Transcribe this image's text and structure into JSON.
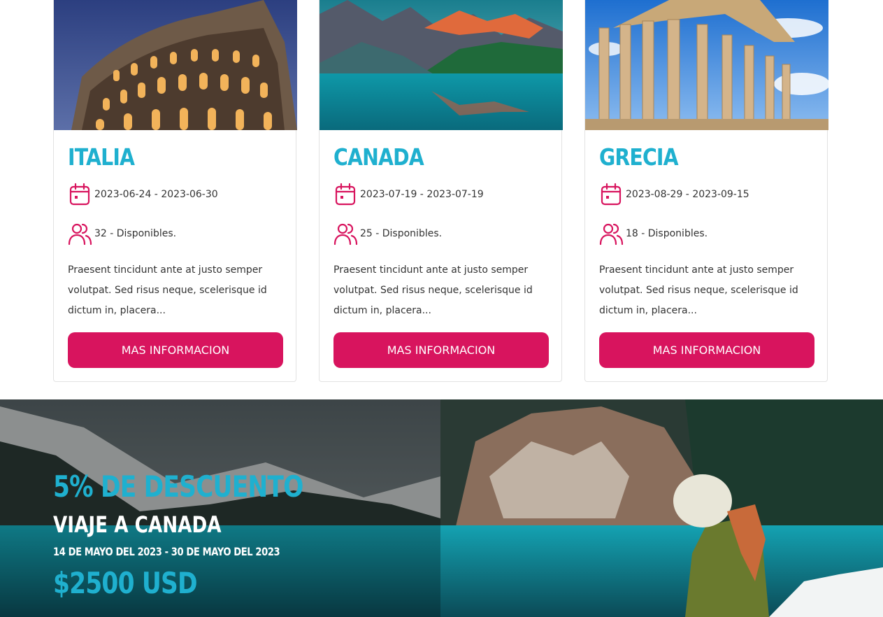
{
  "cards": [
    {
      "title": "ITALIA",
      "dates": "2023-06-24 - 2023-06-30",
      "availability": "32 - Disponibles.",
      "description": "Praesent tincidunt ante at justo semper volutpat. Sed risus neque, scelerisque id dictum in, placera...",
      "button_label": "MAS INFORMACION"
    },
    {
      "title": "CANADA",
      "dates": "2023-07-19 - 2023-07-19",
      "availability": "25 - Disponibles.",
      "description": "Praesent tincidunt ante at justo semper volutpat. Sed risus neque, scelerisque id dictum in, placera...",
      "button_label": "MAS INFORMACION"
    },
    {
      "title": "GRECIA",
      "dates": "2023-08-29 - 2023-09-15",
      "availability": "18 - Disponibles.",
      "description": "Praesent tincidunt ante at justo semper volutpat. Sed risus neque, scelerisque id dictum in, placera...",
      "button_label": "MAS INFORMACION"
    }
  ],
  "icons": {
    "dates": "calendar-icon",
    "availability": "users-icon"
  },
  "banner": {
    "discount": "5% DE DESCUENTO",
    "trip": "VIAJE A CANADA",
    "dates": "14 DE MAYO DEL 2023 - 30 DE MAYO DEL 2023",
    "price": "$2500 USD"
  },
  "colors": {
    "accent": "#1fb0cf",
    "button": "#d8145e",
    "icon": "#d8145e"
  }
}
